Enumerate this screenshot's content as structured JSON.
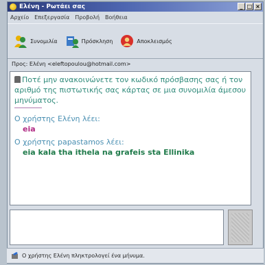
{
  "window": {
    "title": "Ελένη - Ρωτάει σας"
  },
  "menu": [
    "Αρχείο",
    "Επεξεργασία",
    "Προβολή",
    "Βοήθεια"
  ],
  "toolbar": {
    "buttons": [
      {
        "label": "Συνομιλία",
        "icon": "chat-people-icon"
      },
      {
        "label": "Πρόσκληση",
        "icon": "invite-icon"
      },
      {
        "label": "Αποκλεισμός",
        "icon": "block-icon"
      }
    ]
  },
  "to_line": "Προς: Ελένη <eleftopoulou@hotmail.com>",
  "chat": {
    "warning": "Ποτέ μην ανακοινώνετε τον κωδικό πρόσβασης σας ή τον αριθμό της πιστωτικής σας κάρτας σε μια συνομιλία άμεσου μηνύματος.",
    "messages": [
      {
        "header": "Ο χρήστης Ελένη λέει:",
        "text": "eia"
      },
      {
        "header": "Ο χρήστης papastamos λέει:",
        "text": "eia kala tha ithela na grafeis sta Ellinika"
      }
    ]
  },
  "status_text": "Ο χρήστης Ελένη πληκτρολογεί ένα μήνυμα."
}
